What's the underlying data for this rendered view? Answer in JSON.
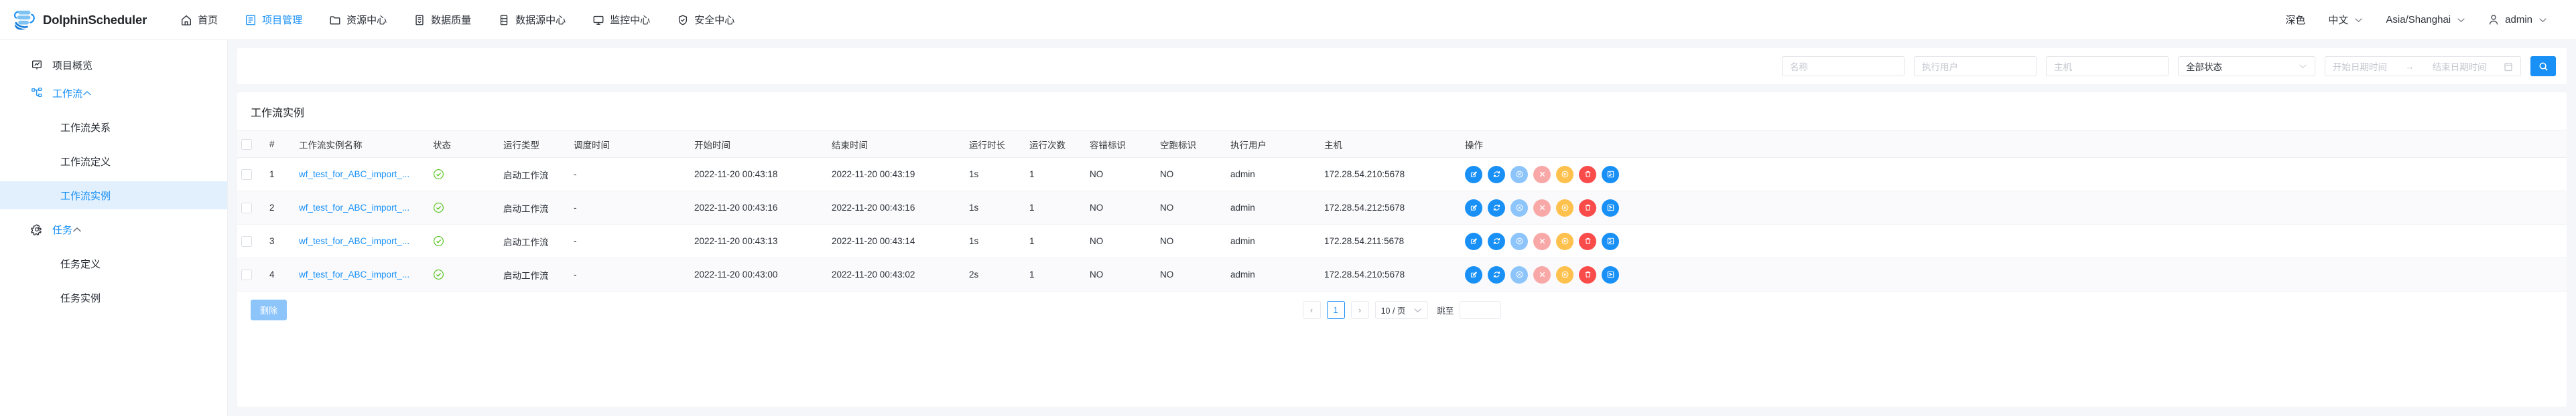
{
  "header": {
    "brand": "DolphinScheduler",
    "nav": [
      {
        "label": "首页",
        "icon": "home-icon",
        "active": false
      },
      {
        "label": "项目管理",
        "icon": "project-icon",
        "active": true
      },
      {
        "label": "资源中心",
        "icon": "folder-icon",
        "active": false
      },
      {
        "label": "数据质量",
        "icon": "data-quality-icon",
        "active": false
      },
      {
        "label": "数据源中心",
        "icon": "database-icon",
        "active": false
      },
      {
        "label": "监控中心",
        "icon": "monitor-icon",
        "active": false
      },
      {
        "label": "安全中心",
        "icon": "shield-icon",
        "active": false
      }
    ],
    "theme_label": "深色",
    "language_label": "中文",
    "timezone_label": "Asia/Shanghai",
    "user_label": "admin"
  },
  "sidebar": {
    "items": [
      {
        "label": "项目概览",
        "icon": "overview-icon",
        "type": "item",
        "active": false
      },
      {
        "label": "工作流",
        "icon": "workflow-icon",
        "type": "group",
        "open": true
      },
      {
        "label": "工作流关系",
        "type": "sub",
        "active": false
      },
      {
        "label": "工作流定义",
        "type": "sub",
        "active": false
      },
      {
        "label": "工作流实例",
        "type": "sub",
        "active": true
      },
      {
        "label": "任务",
        "icon": "gear-icon",
        "type": "group",
        "open": true
      },
      {
        "label": "任务定义",
        "type": "sub",
        "active": false
      },
      {
        "label": "任务实例",
        "type": "sub",
        "active": false
      }
    ]
  },
  "filters": {
    "name_placeholder": "名称",
    "exec_user_placeholder": "执行用户",
    "host_placeholder": "主机",
    "status_value": "全部状态",
    "start_date_placeholder": "开始日期时间",
    "date_range_arrow": "→",
    "end_date_placeholder": "结束日期时间"
  },
  "table": {
    "title": "工作流实例",
    "columns": [
      "",
      "#",
      "工作流实例名称",
      "状态",
      "运行类型",
      "调度时间",
      "开始时间",
      "结束时间",
      "运行时长",
      "运行次数",
      "容错标识",
      "空跑标识",
      "执行用户",
      "主机",
      "操作"
    ],
    "rows": [
      {
        "index": "1",
        "name": "wf_test_for_ABC_import_...",
        "status": "success",
        "run_type": "启动工作流",
        "schedule_time": "-",
        "start_time": "2022-11-20 00:43:18",
        "end_time": "2022-11-20 00:43:19",
        "duration": "1s",
        "run_times": "1",
        "fault_tolerant": "NO",
        "dry_run": "NO",
        "exec_user": "admin",
        "host": "172.28.54.210:5678"
      },
      {
        "index": "2",
        "name": "wf_test_for_ABC_import_...",
        "status": "success",
        "run_type": "启动工作流",
        "schedule_time": "-",
        "start_time": "2022-11-20 00:43:16",
        "end_time": "2022-11-20 00:43:16",
        "duration": "1s",
        "run_times": "1",
        "fault_tolerant": "NO",
        "dry_run": "NO",
        "exec_user": "admin",
        "host": "172.28.54.212:5678"
      },
      {
        "index": "3",
        "name": "wf_test_for_ABC_import_...",
        "status": "success",
        "run_type": "启动工作流",
        "schedule_time": "-",
        "start_time": "2022-11-20 00:43:13",
        "end_time": "2022-11-20 00:43:14",
        "duration": "1s",
        "run_times": "1",
        "fault_tolerant": "NO",
        "dry_run": "NO",
        "exec_user": "admin",
        "host": "172.28.54.211:5678"
      },
      {
        "index": "4",
        "name": "wf_test_for_ABC_import_...",
        "status": "success",
        "run_type": "启动工作流",
        "schedule_time": "-",
        "start_time": "2022-11-20 00:43:00",
        "end_time": "2022-11-20 00:43:02",
        "duration": "2s",
        "run_times": "1",
        "fault_tolerant": "NO",
        "dry_run": "NO",
        "exec_user": "admin",
        "host": "172.28.54.210:5678"
      }
    ],
    "operations": [
      {
        "name": "edit",
        "icon": "edit-icon",
        "color": "#1890f6"
      },
      {
        "name": "rerun",
        "icon": "rerun-icon",
        "color": "#1890f6"
      },
      {
        "name": "stop",
        "icon": "stop-icon",
        "color": "#8dc5fb"
      },
      {
        "name": "kill",
        "icon": "close-icon",
        "color": "#f9a8a8"
      },
      {
        "name": "pause",
        "icon": "pause-icon",
        "color": "#ffc14d"
      },
      {
        "name": "delete",
        "icon": "trash-icon",
        "color": "#fa4b4b"
      },
      {
        "name": "gantt",
        "icon": "gantt-icon",
        "color": "#1890f6"
      }
    ]
  },
  "footer": {
    "delete_label": "删除",
    "prev_label": "‹",
    "current_page": "1",
    "next_label": "›",
    "page_size_label": "10 / 页",
    "goto_label": "跳至"
  },
  "colors": {
    "accent": "#1890f6",
    "success": "#52c41a",
    "sidebar_active_bg": "#e2f0fe",
    "page_bg": "#f4f6f9"
  }
}
